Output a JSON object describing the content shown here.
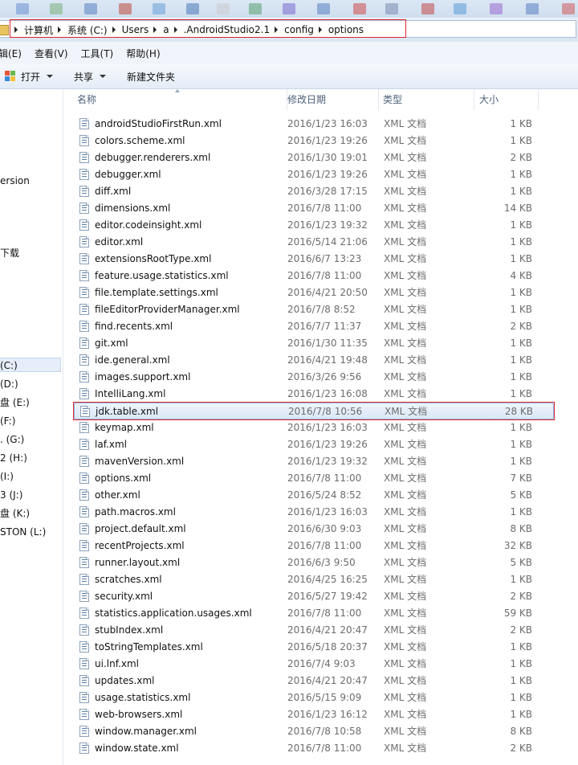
{
  "address": {
    "crumbs": [
      "计算机",
      "系统 (C:)",
      "Users",
      "a",
      ".AndroidStudio2.1",
      "config",
      "options"
    ]
  },
  "menu": [
    "辑(E)",
    "查看(V)",
    "工具(T)",
    "帮助(H)"
  ],
  "toolbar": {
    "open": "打开",
    "share": "共享",
    "new_folder": "新建文件夹"
  },
  "nav": {
    "items": [
      "ersion",
      "下载",
      "(C:)",
      "(D:)",
      "盘 (E:)",
      "(F:)",
      ". (G:)",
      "2 (H:)",
      "(I:)",
      "3 (J:)",
      "盘 (K:)",
      "STON (L:)"
    ]
  },
  "columns": {
    "name": "名称",
    "date": "修改日期",
    "type": "类型",
    "size": "大小"
  },
  "files": [
    {
      "name": "androidStudioFirstRun.xml",
      "date": "2016/1/23 16:03",
      "type": "XML 文档",
      "size": "1 KB"
    },
    {
      "name": "colors.scheme.xml",
      "date": "2016/1/23 19:26",
      "type": "XML 文档",
      "size": "1 KB"
    },
    {
      "name": "debugger.renderers.xml",
      "date": "2016/1/30 19:01",
      "type": "XML 文档",
      "size": "2 KB"
    },
    {
      "name": "debugger.xml",
      "date": "2016/1/23 19:26",
      "type": "XML 文档",
      "size": "1 KB"
    },
    {
      "name": "diff.xml",
      "date": "2016/3/28 17:15",
      "type": "XML 文档",
      "size": "1 KB"
    },
    {
      "name": "dimensions.xml",
      "date": "2016/7/8 11:00",
      "type": "XML 文档",
      "size": "14 KB"
    },
    {
      "name": "editor.codeinsight.xml",
      "date": "2016/1/23 19:32",
      "type": "XML 文档",
      "size": "1 KB"
    },
    {
      "name": "editor.xml",
      "date": "2016/5/14 21:06",
      "type": "XML 文档",
      "size": "1 KB"
    },
    {
      "name": "extensionsRootType.xml",
      "date": "2016/6/7 13:23",
      "type": "XML 文档",
      "size": "1 KB"
    },
    {
      "name": "feature.usage.statistics.xml",
      "date": "2016/7/8 11:00",
      "type": "XML 文档",
      "size": "4 KB"
    },
    {
      "name": "file.template.settings.xml",
      "date": "2016/4/21 20:50",
      "type": "XML 文档",
      "size": "1 KB"
    },
    {
      "name": "fileEditorProviderManager.xml",
      "date": "2016/7/8 8:52",
      "type": "XML 文档",
      "size": "1 KB"
    },
    {
      "name": "find.recents.xml",
      "date": "2016/7/7 11:37",
      "type": "XML 文档",
      "size": "2 KB"
    },
    {
      "name": "git.xml",
      "date": "2016/1/30 11:35",
      "type": "XML 文档",
      "size": "1 KB"
    },
    {
      "name": "ide.general.xml",
      "date": "2016/4/21 19:48",
      "type": "XML 文档",
      "size": "1 KB"
    },
    {
      "name": "images.support.xml",
      "date": "2016/3/26 9:56",
      "type": "XML 文档",
      "size": "1 KB"
    },
    {
      "name": "IntelliLang.xml",
      "date": "2016/1/23 16:08",
      "type": "XML 文档",
      "size": "1 KB"
    },
    {
      "name": "jdk.table.xml",
      "date": "2016/7/8 10:56",
      "type": "XML 文档",
      "size": "28 KB"
    },
    {
      "name": "keymap.xml",
      "date": "2016/1/23 16:03",
      "type": "XML 文档",
      "size": "1 KB"
    },
    {
      "name": "laf.xml",
      "date": "2016/1/23 19:26",
      "type": "XML 文档",
      "size": "1 KB"
    },
    {
      "name": "mavenVersion.xml",
      "date": "2016/1/23 19:32",
      "type": "XML 文档",
      "size": "1 KB"
    },
    {
      "name": "options.xml",
      "date": "2016/7/8 11:00",
      "type": "XML 文档",
      "size": "7 KB"
    },
    {
      "name": "other.xml",
      "date": "2016/5/24 8:52",
      "type": "XML 文档",
      "size": "5 KB"
    },
    {
      "name": "path.macros.xml",
      "date": "2016/1/23 16:03",
      "type": "XML 文档",
      "size": "1 KB"
    },
    {
      "name": "project.default.xml",
      "date": "2016/6/30 9:03",
      "type": "XML 文档",
      "size": "8 KB"
    },
    {
      "name": "recentProjects.xml",
      "date": "2016/7/8 11:00",
      "type": "XML 文档",
      "size": "32 KB"
    },
    {
      "name": "runner.layout.xml",
      "date": "2016/6/3 9:50",
      "type": "XML 文档",
      "size": "5 KB"
    },
    {
      "name": "scratches.xml",
      "date": "2016/4/25 16:25",
      "type": "XML 文档",
      "size": "1 KB"
    },
    {
      "name": "security.xml",
      "date": "2016/5/27 19:42",
      "type": "XML 文档",
      "size": "2 KB"
    },
    {
      "name": "statistics.application.usages.xml",
      "date": "2016/7/8 11:00",
      "type": "XML 文档",
      "size": "59 KB"
    },
    {
      "name": "stubIndex.xml",
      "date": "2016/4/21 20:47",
      "type": "XML 文档",
      "size": "2 KB"
    },
    {
      "name": "toStringTemplates.xml",
      "date": "2016/5/18 20:37",
      "type": "XML 文档",
      "size": "1 KB"
    },
    {
      "name": "ui.lnf.xml",
      "date": "2016/7/4 9:03",
      "type": "XML 文档",
      "size": "1 KB"
    },
    {
      "name": "updates.xml",
      "date": "2016/4/21 20:47",
      "type": "XML 文档",
      "size": "1 KB"
    },
    {
      "name": "usage.statistics.xml",
      "date": "2016/5/15 9:09",
      "type": "XML 文档",
      "size": "1 KB"
    },
    {
      "name": "web-browsers.xml",
      "date": "2016/1/23 16:12",
      "type": "XML 文档",
      "size": "1 KB"
    },
    {
      "name": "window.manager.xml",
      "date": "2016/7/8 10:58",
      "type": "XML 文档",
      "size": "8 KB"
    },
    {
      "name": "window.state.xml",
      "date": "2016/7/8 11:00",
      "type": "XML 文档",
      "size": "2 KB"
    }
  ],
  "selected_file_index": 17,
  "colors": {
    "highlight": "#e0262b",
    "selection": "#dbe8f8"
  }
}
